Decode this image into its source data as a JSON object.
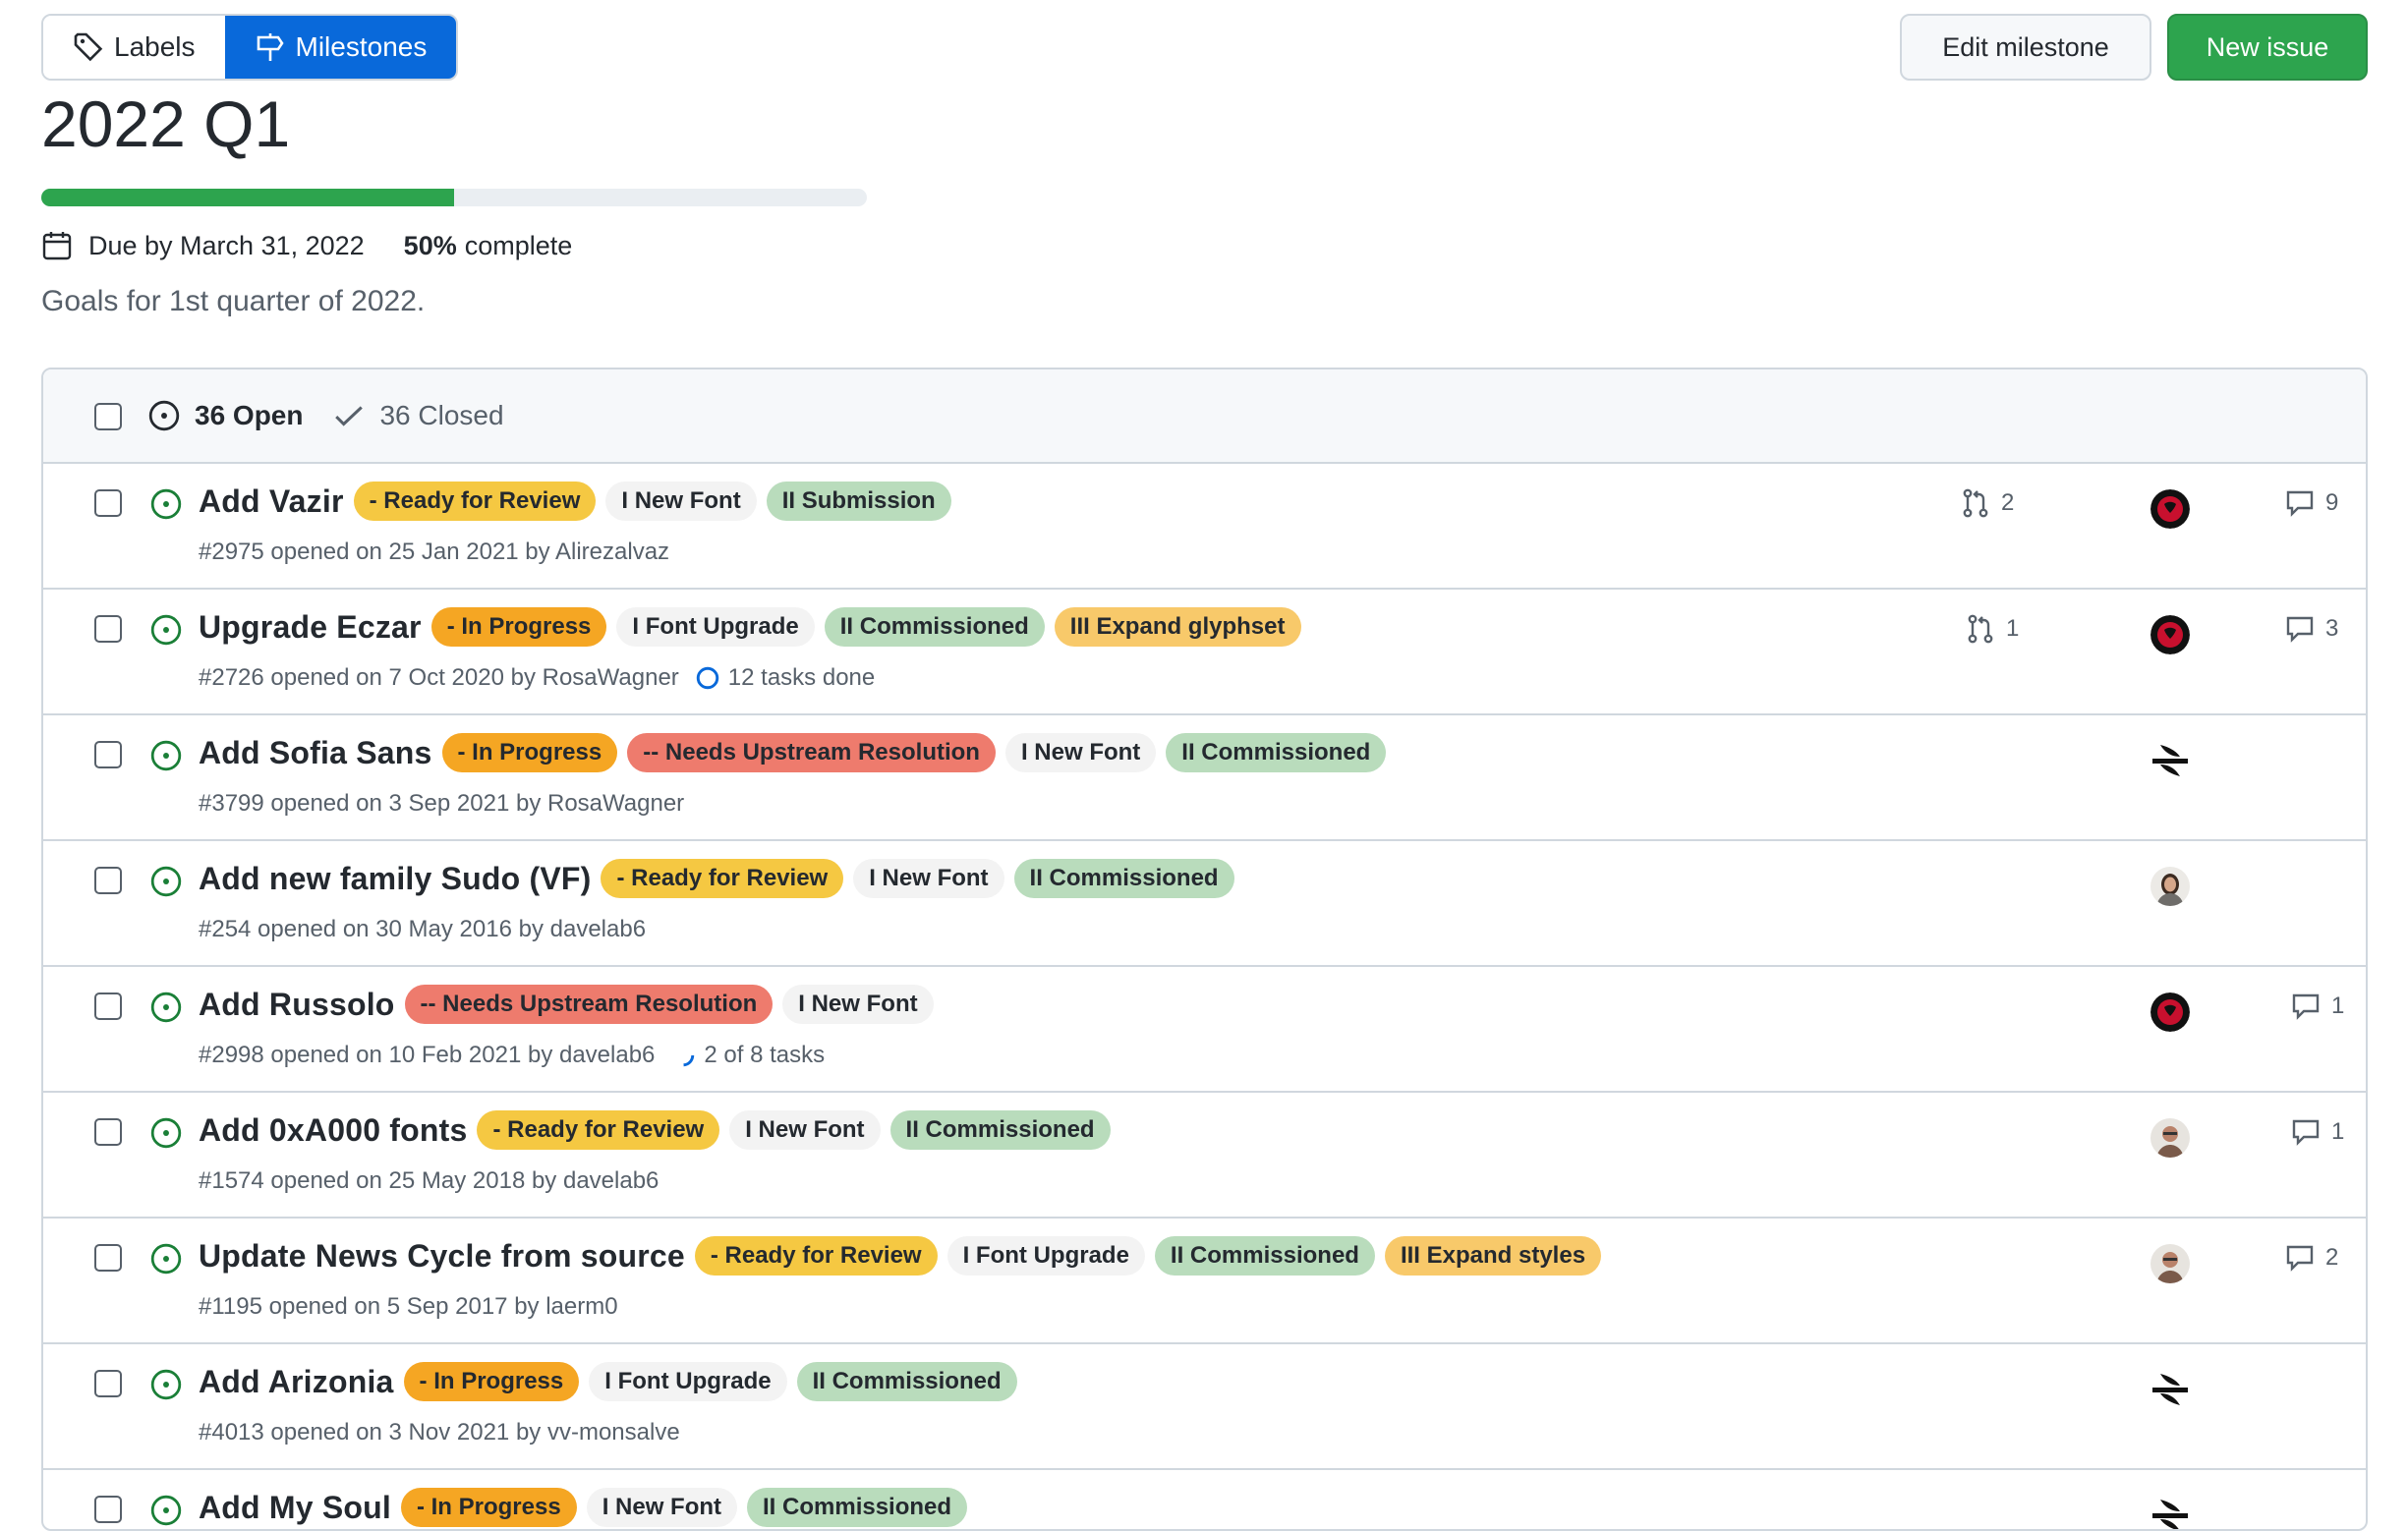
{
  "tabs": {
    "labels": "Labels",
    "milestones": "Milestones"
  },
  "actions": {
    "edit": "Edit milestone",
    "new_issue": "New issue"
  },
  "milestone": {
    "title": "2022 Q1",
    "progress_fraction": 0.5,
    "due": "Due by March 31, 2022",
    "percent": "50%",
    "complete_text": "complete",
    "description": "Goals for 1st quarter of 2022."
  },
  "states": {
    "open": "36 Open",
    "closed": "36 Closed"
  },
  "colors": {
    "accent": "#0969da",
    "success": "#2da44e",
    "open_icon": "#1a7f37"
  },
  "issues": [
    {
      "title": "Add Vazir",
      "labels": [
        "- Ready for Review",
        "I New Font",
        "II Submission"
      ],
      "meta": "#2975 opened on 25 Jan 2021 by Alirezalvaz",
      "prs": "2",
      "comments": "9",
      "avatar": "red-logo"
    },
    {
      "title": "Upgrade Eczar",
      "labels": [
        "- In Progress",
        "I Font Upgrade",
        "II Commissioned",
        "III Expand glyphset"
      ],
      "meta": "#2726 opened on 7 Oct 2020 by RosaWagner",
      "tasks": "12 tasks done",
      "prs": "1",
      "comments": "3",
      "avatar": "red-logo"
    },
    {
      "title": "Add Sofia Sans",
      "labels": [
        "- In Progress",
        "-- Needs Upstream Resolution",
        "I New Font",
        "II Commissioned"
      ],
      "meta": "#3799 opened on 3 Sep 2021 by RosaWagner",
      "avatar": "black-logo"
    },
    {
      "title": "Add new family Sudo (VF)",
      "labels": [
        "- Ready for Review",
        "I New Font",
        "II Commissioned"
      ],
      "meta": "#254 opened on 30 May 2016 by davelab6",
      "avatar": "person-a"
    },
    {
      "title": "Add Russolo",
      "labels": [
        "-- Needs Upstream Resolution",
        "I New Font"
      ],
      "meta": "#2998 opened on 10 Feb 2021 by davelab6",
      "tasks": "2 of 8 tasks",
      "comments": "1",
      "avatar": "red-logo"
    },
    {
      "title": "Add 0xA000 fonts",
      "labels": [
        "- Ready for Review",
        "I New Font",
        "II Commissioned"
      ],
      "meta": "#1574 opened on 25 May 2018 by davelab6",
      "comments": "1",
      "avatar": "person-b"
    },
    {
      "title": "Update News Cycle from source",
      "labels": [
        "- Ready for Review",
        "I Font Upgrade",
        "II Commissioned",
        "III Expand styles"
      ],
      "meta": "#1195 opened on 5 Sep 2017 by laerm0",
      "comments": "2",
      "avatar": "person-b"
    },
    {
      "title": "Add Arizonia",
      "labels": [
        "- In Progress",
        "I Font Upgrade",
        "II Commissioned"
      ],
      "meta": "#4013 opened on 3 Nov 2021 by vv-monsalve",
      "avatar": "black-logo"
    },
    {
      "title": "Add My Soul",
      "labels": [
        "- In Progress",
        "I New Font",
        "II Commissioned"
      ],
      "meta": "",
      "avatar": "black-logo"
    }
  ]
}
